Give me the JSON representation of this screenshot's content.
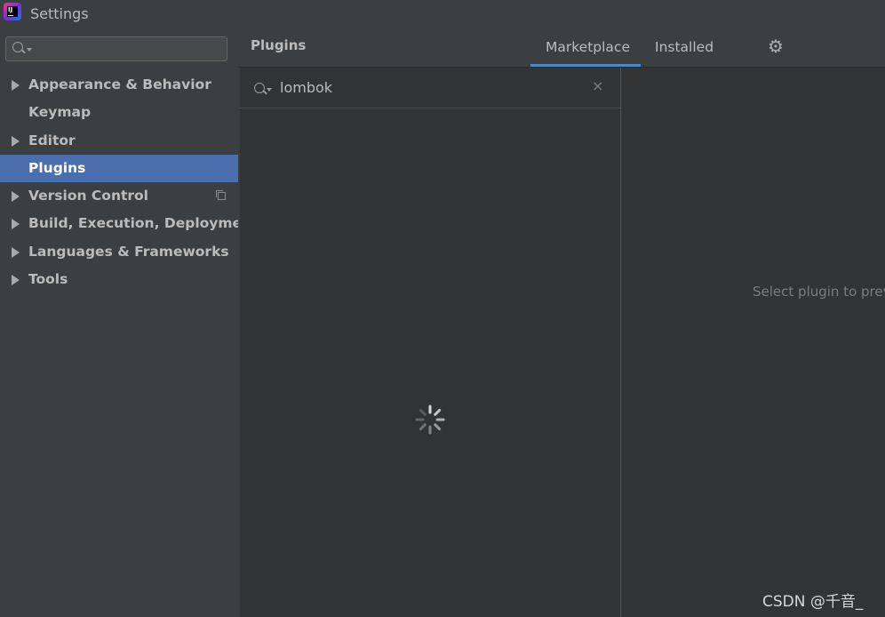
{
  "window": {
    "title": "Settings"
  },
  "sidebar": {
    "search": {
      "placeholder": ""
    },
    "items": [
      {
        "label": "Appearance & Behavior",
        "expandable": true,
        "selected": false
      },
      {
        "label": "Keymap",
        "expandable": false,
        "selected": false
      },
      {
        "label": "Editor",
        "expandable": true,
        "selected": false
      },
      {
        "label": "Plugins",
        "expandable": false,
        "selected": true
      },
      {
        "label": "Version Control",
        "expandable": true,
        "selected": false,
        "trailing_icon": "copy-icon"
      },
      {
        "label": "Build, Execution, Deployment",
        "expandable": true,
        "selected": false
      },
      {
        "label": "Languages & Frameworks",
        "expandable": true,
        "selected": false
      },
      {
        "label": "Tools",
        "expandable": true,
        "selected": false
      }
    ]
  },
  "main": {
    "title": "Plugins",
    "tabs": [
      {
        "label": "Marketplace",
        "active": true
      },
      {
        "label": "Installed",
        "active": false
      }
    ],
    "settings_icon": "gear-icon",
    "search": {
      "value": "lombok",
      "clear_glyph": "×"
    },
    "loading": true,
    "detail_hint": "Select plugin to prev"
  },
  "colors": {
    "background": "#3c3f41",
    "pane": "#313335",
    "selection": "#4b6eaf",
    "tab_underline": "#4a88c7"
  },
  "watermark": "CSDN @千音_"
}
